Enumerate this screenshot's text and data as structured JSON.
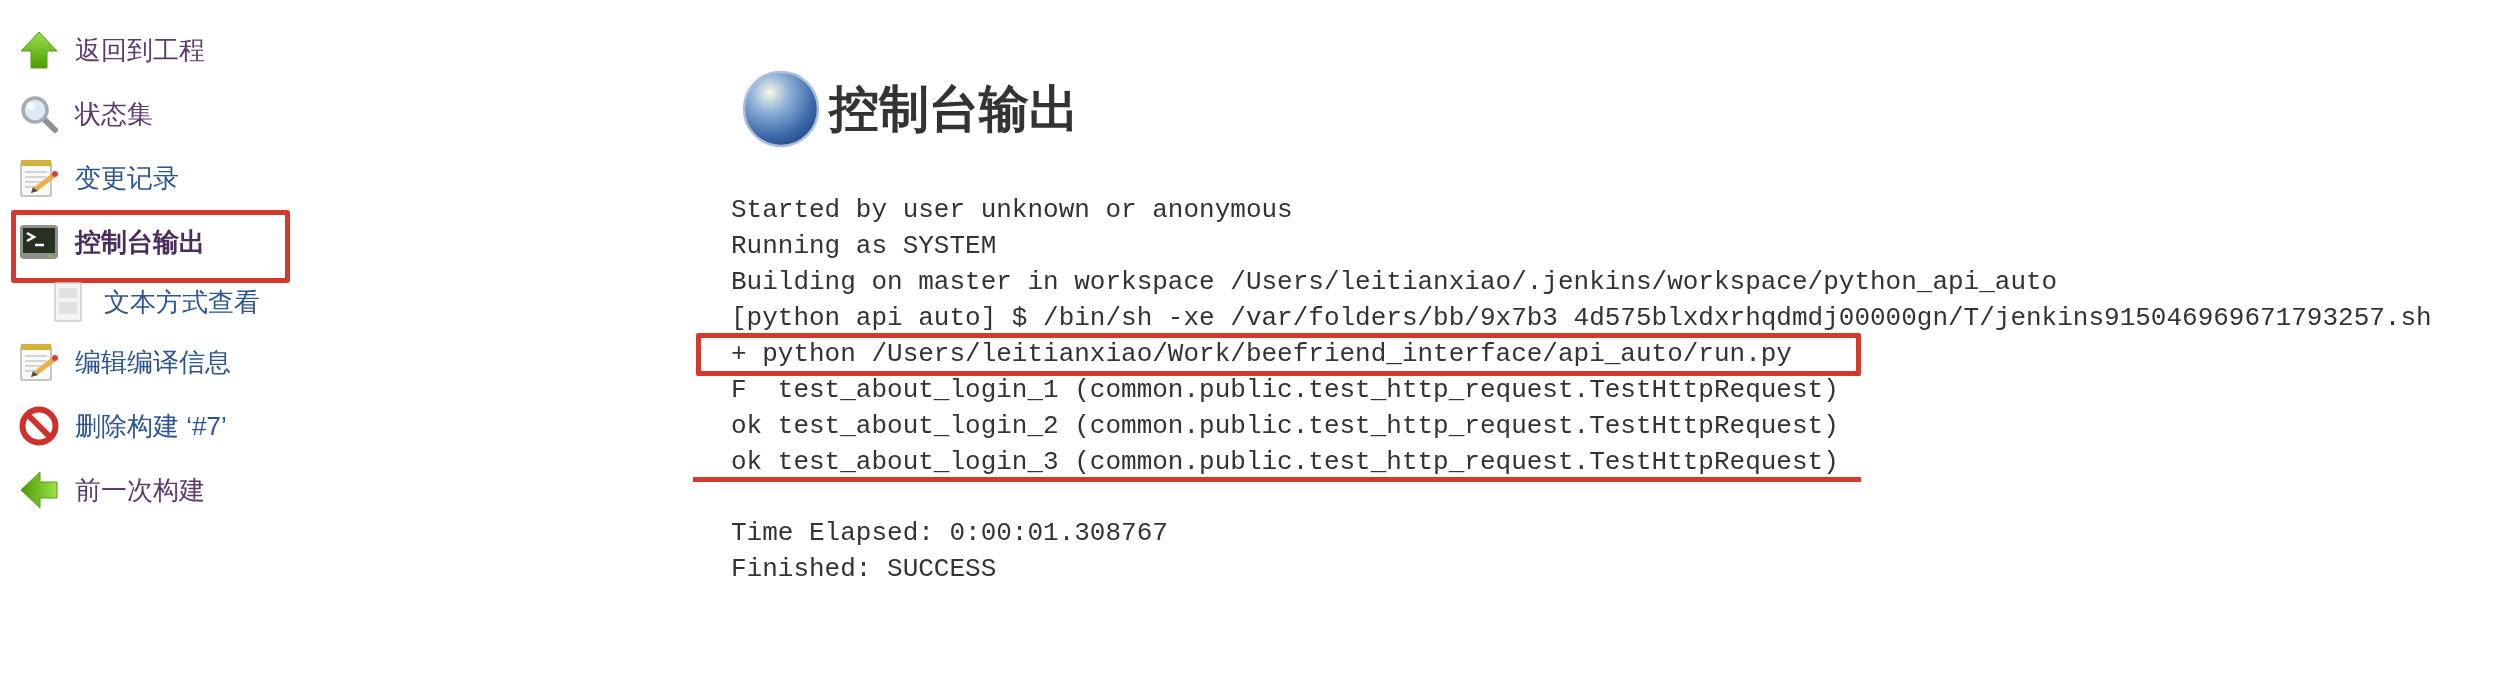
{
  "sidebar": {
    "items": [
      {
        "kind": "back",
        "label": "返回到工程",
        "visited": true,
        "selected": false,
        "highlighted": false
      },
      {
        "kind": "status",
        "label": "状态集",
        "visited": true,
        "selected": false,
        "highlighted": false
      },
      {
        "kind": "changes",
        "label": "变更记录",
        "visited": false,
        "selected": false,
        "highlighted": false
      },
      {
        "kind": "console",
        "label": "控制台输出",
        "visited": true,
        "selected": true,
        "highlighted": true,
        "children": [
          {
            "kind": "text",
            "label": "文本方式查看",
            "visited": false,
            "selected": false,
            "highlighted": false
          }
        ]
      },
      {
        "kind": "edit",
        "label": "编辑编译信息",
        "visited": false,
        "selected": false,
        "highlighted": false
      },
      {
        "kind": "delete",
        "label": "删除构建 ‘#7’",
        "visited": false,
        "selected": false,
        "highlighted": false
      },
      {
        "kind": "previous",
        "label": "前一次构建",
        "visited": true,
        "selected": false,
        "highlighted": false
      }
    ]
  },
  "main": {
    "title": "控制台输出",
    "console": {
      "groups": [
        {
          "lines": [
            {
              "text": "Started by user unknown or anonymous",
              "boxed": false,
              "underlined": false
            },
            {
              "text": "Running as SYSTEM",
              "boxed": false,
              "underlined": false
            },
            {
              "text": "Building on master in workspace /Users/leitianxiao/.jenkins/workspace/python_api_auto",
              "boxed": false,
              "underlined": false
            },
            {
              "text": "[python api auto] $ /bin/sh -xe /var/folders/bb/9x7b3 4d575blxdxrhqdmdj00000gn/T/jenkins915046969671793257.sh",
              "boxed": false,
              "underlined": false
            },
            {
              "text": "+ python /Users/leitianxiao/Work/beefriend_interface/api_auto/run.py",
              "boxed": true,
              "underlined": false
            },
            {
              "text": "F  test_about_login_1 (common.public.test_http_request.TestHttpRequest)",
              "boxed": false,
              "underlined": false
            },
            {
              "text": "ok test_about_login_2 (common.public.test_http_request.TestHttpRequest)",
              "boxed": false,
              "underlined": false
            },
            {
              "text": "ok test_about_login_3 (common.public.test_http_request.TestHttpRequest)",
              "boxed": false,
              "underlined": true
            }
          ]
        },
        {
          "lines": [
            {
              "text": "Time Elapsed: 0:00:01.308767",
              "boxed": false,
              "underlined": false
            },
            {
              "text": "Finished: SUCCESS",
              "boxed": false,
              "underlined": false
            }
          ]
        }
      ]
    }
  }
}
